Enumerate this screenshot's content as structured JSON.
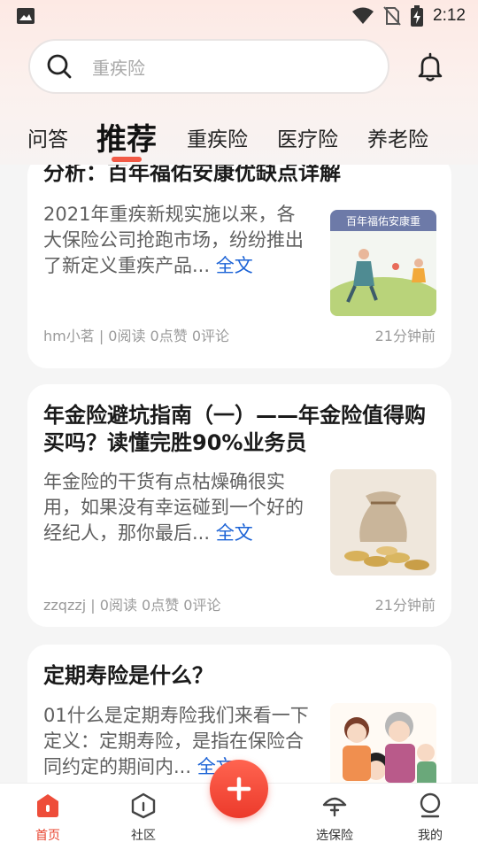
{
  "status_bar": {
    "time": "2:12",
    "icons": [
      "image-icon",
      "wifi-icon",
      "no-sim-icon",
      "battery-charging-icon"
    ]
  },
  "search": {
    "placeholder": "重疾险",
    "icon": "search-icon"
  },
  "notification": {
    "icon": "bell-icon"
  },
  "tabs": [
    {
      "label": "问答",
      "active": false
    },
    {
      "label": "推荐",
      "active": true
    },
    {
      "label": "重疾险",
      "active": false
    },
    {
      "label": "医疗险",
      "active": false
    },
    {
      "label": "养老险",
      "active": false
    }
  ],
  "articles": [
    {
      "title": "分析：百年福佑安康优缺点详解",
      "excerpt": "2021年重疾新规实施以来，各大保险公司抢跑市场，纷纷推出了新定义重疾产品...",
      "more_label": "全文",
      "thumb_text": "百年福佑安康重",
      "author_stats": "hm小茗 | 0阅读 0点赞 0评论",
      "time": "21分钟前"
    },
    {
      "title": "年金险避坑指南（一）——年金险值得购买吗？读懂完胜90%业务员",
      "excerpt": "年金险的干货有点枯燥确很实用，如果没有幸运碰到一个好的经纪人，那你最后...",
      "more_label": "全文",
      "author_stats": "zzqzzj | 0阅读 0点赞 0评论",
      "time": "21分钟前"
    },
    {
      "title": "定期寿险是什么？",
      "excerpt": "01什么是定期寿险我们来看一下定义：定期寿险，是指在保险合同约定的期间内...",
      "more_label": "全文"
    }
  ],
  "bottom_nav": [
    {
      "label": "首页",
      "icon": "home-icon",
      "active": true
    },
    {
      "label": "社区",
      "icon": "community-icon",
      "active": false
    },
    {
      "label": "选保险",
      "icon": "umbrella-icon",
      "active": false
    },
    {
      "label": "我的",
      "icon": "profile-icon",
      "active": false
    }
  ],
  "fab": {
    "icon": "plus-icon"
  },
  "colors": {
    "accent": "#f25a46",
    "link": "#1c63d6",
    "background": "#f5f5f5"
  }
}
